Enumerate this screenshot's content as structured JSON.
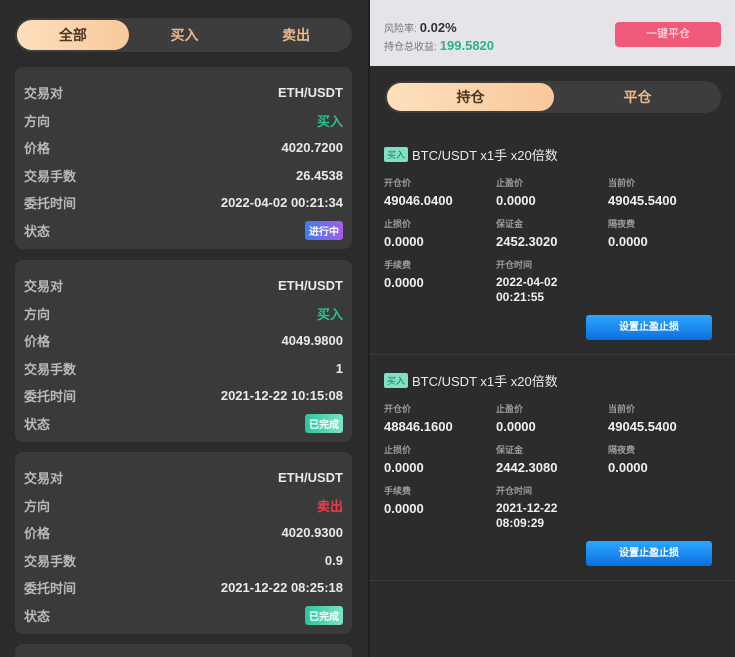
{
  "left": {
    "segments": [
      "全部",
      "买入",
      "卖出"
    ],
    "labels": {
      "pair": "交易对",
      "direction": "方向",
      "price": "价格",
      "qty": "交易手数",
      "time": "委托时间",
      "status": "状态"
    },
    "orders": [
      {
        "pair": "ETH/USDT",
        "direction": "买入",
        "price": "4020.7200",
        "qty": "26.4538",
        "time": "2022-04-02 00:21:34",
        "status": "进行中"
      },
      {
        "pair": "ETH/USDT",
        "direction": "买入",
        "price": "4049.9800",
        "qty": "1",
        "time": "2021-12-22 10:15:08",
        "status": "已完成"
      },
      {
        "pair": "ETH/USDT",
        "direction": "卖出",
        "price": "4020.9300",
        "qty": "0.9",
        "time": "2021-12-22 08:25:18",
        "status": "已完成"
      }
    ]
  },
  "right": {
    "risk_label": "风险率:",
    "risk_value": "0.02%",
    "pnl_label": "持仓总收益:",
    "pnl_value": "199.5820",
    "close_all": "一键平仓",
    "tabs": [
      "持仓",
      "平仓"
    ],
    "field_labels": {
      "open": "开仓价",
      "tp": "止盈价",
      "current": "当前价",
      "sl": "止损价",
      "margin": "保证金",
      "overnight": "隔夜费",
      "fee": "手续费",
      "open_time": "开仓时间"
    },
    "positions": [
      {
        "tag": "买入",
        "title": "BTC/USDT x1手 x20倍数",
        "open": "49046.0400",
        "tp": "0.0000",
        "current": "49045.5400",
        "sl": "0.0000",
        "margin": "2452.3020",
        "overnight": "0.0000",
        "fee": "0.0000",
        "open_time_date": "2022-04-02",
        "open_time_clock": "00:21:55",
        "button": "设置止盈止损"
      },
      {
        "tag": "买入",
        "title": "BTC/USDT x1手 x20倍数",
        "open": "48846.1600",
        "tp": "0.0000",
        "current": "49045.5400",
        "sl": "0.0000",
        "margin": "2442.3080",
        "overnight": "0.0000",
        "fee": "0.0000",
        "open_time_date": "2021-12-22",
        "open_time_clock": "08:09:29",
        "button": "设置止盈止损"
      }
    ]
  }
}
